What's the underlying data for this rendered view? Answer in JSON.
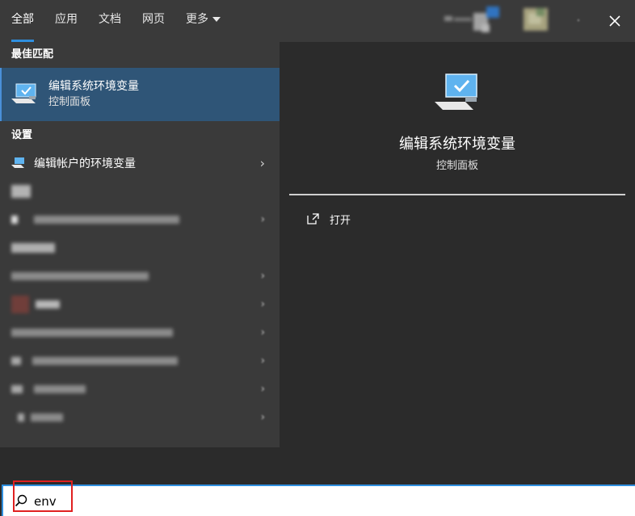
{
  "header": {
    "tabs": [
      {
        "label": "全部",
        "active": true
      },
      {
        "label": "应用",
        "active": false
      },
      {
        "label": "文档",
        "active": false
      },
      {
        "label": "网页",
        "active": false
      },
      {
        "label": "更多",
        "active": false,
        "dropdown": true
      }
    ],
    "right_icons": [
      "blurred-account-icon",
      "blurred-avatar-icon",
      "more-options-icon",
      "close-icon"
    ],
    "close_label": "✕"
  },
  "left_panel": {
    "best_match_heading": "最佳匹配",
    "best_match": {
      "title": "编辑系统环境变量",
      "subtitle": "控制面板",
      "icon": "computer-settings-icon"
    },
    "settings_heading": "设置",
    "settings_items": [
      {
        "label": "编辑帐户的环境变量",
        "icon": "computer-settings-icon",
        "chevron": "›"
      }
    ],
    "blurred_rows": 9,
    "chevron": "›"
  },
  "preview": {
    "title": "编辑系统环境变量",
    "subtitle": "控制面板",
    "icon": "computer-settings-icon",
    "actions": [
      {
        "label": "打开",
        "icon": "open-external-icon"
      }
    ]
  },
  "search": {
    "value": "env",
    "icon": "search-icon"
  },
  "colors": {
    "accent": "#2f8fdf",
    "best_match_bg": "#2f5577",
    "panel_bg": "#3a3a3a",
    "preview_bg": "#2b2b2b",
    "highlight_box": "#e02020"
  }
}
